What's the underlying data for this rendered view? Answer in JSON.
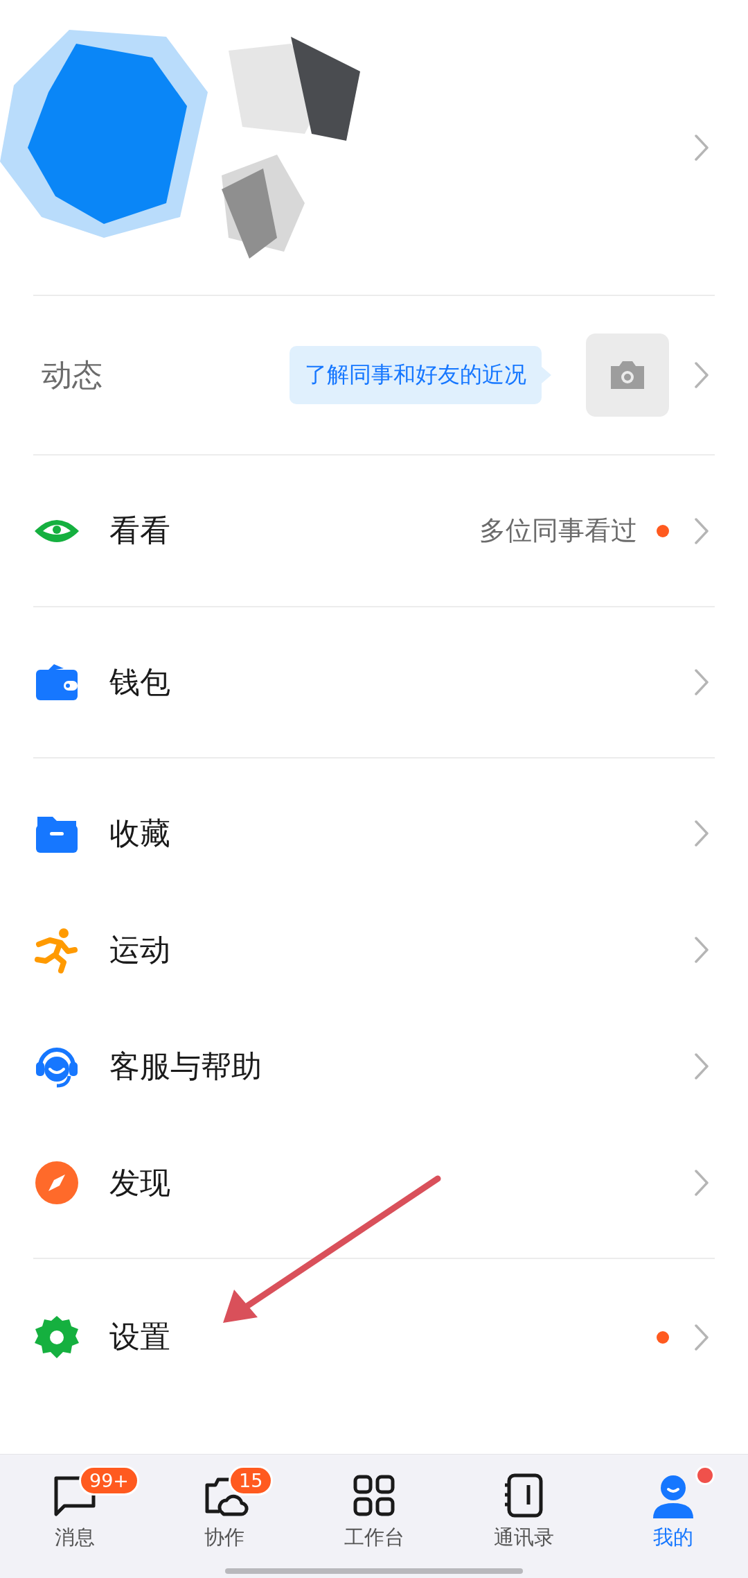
{
  "moments": {
    "label": "动态",
    "tip": "了解同事和好友的近况"
  },
  "groups": [
    {
      "items": [
        {
          "kind": "eye",
          "label": "看看",
          "hint": "多位同事看过",
          "dot": true
        }
      ]
    },
    {
      "items": [
        {
          "kind": "wallet",
          "label": "钱包",
          "dot": false
        }
      ]
    },
    {
      "items": [
        {
          "kind": "folder",
          "label": "收藏",
          "dot": false
        },
        {
          "kind": "runner",
          "label": "运动",
          "dot": false
        },
        {
          "kind": "headset",
          "label": "客服与帮助",
          "dot": false
        },
        {
          "kind": "compass",
          "label": "发现",
          "dot": false
        }
      ]
    },
    {
      "items": [
        {
          "kind": "gear",
          "label": "设置",
          "dot": true
        }
      ]
    }
  ],
  "tabs": [
    {
      "kind": "chat",
      "label": "消息",
      "badge": "99+",
      "dot": false,
      "selected": false
    },
    {
      "kind": "cowork",
      "label": "协作",
      "badge": "15",
      "dot": false,
      "selected": false
    },
    {
      "kind": "grid",
      "label": "工作台",
      "dot": false,
      "selected": false
    },
    {
      "kind": "book",
      "label": "通讯录",
      "dot": false,
      "selected": false
    },
    {
      "kind": "person",
      "label": "我的",
      "dot": true,
      "selected": true
    }
  ]
}
